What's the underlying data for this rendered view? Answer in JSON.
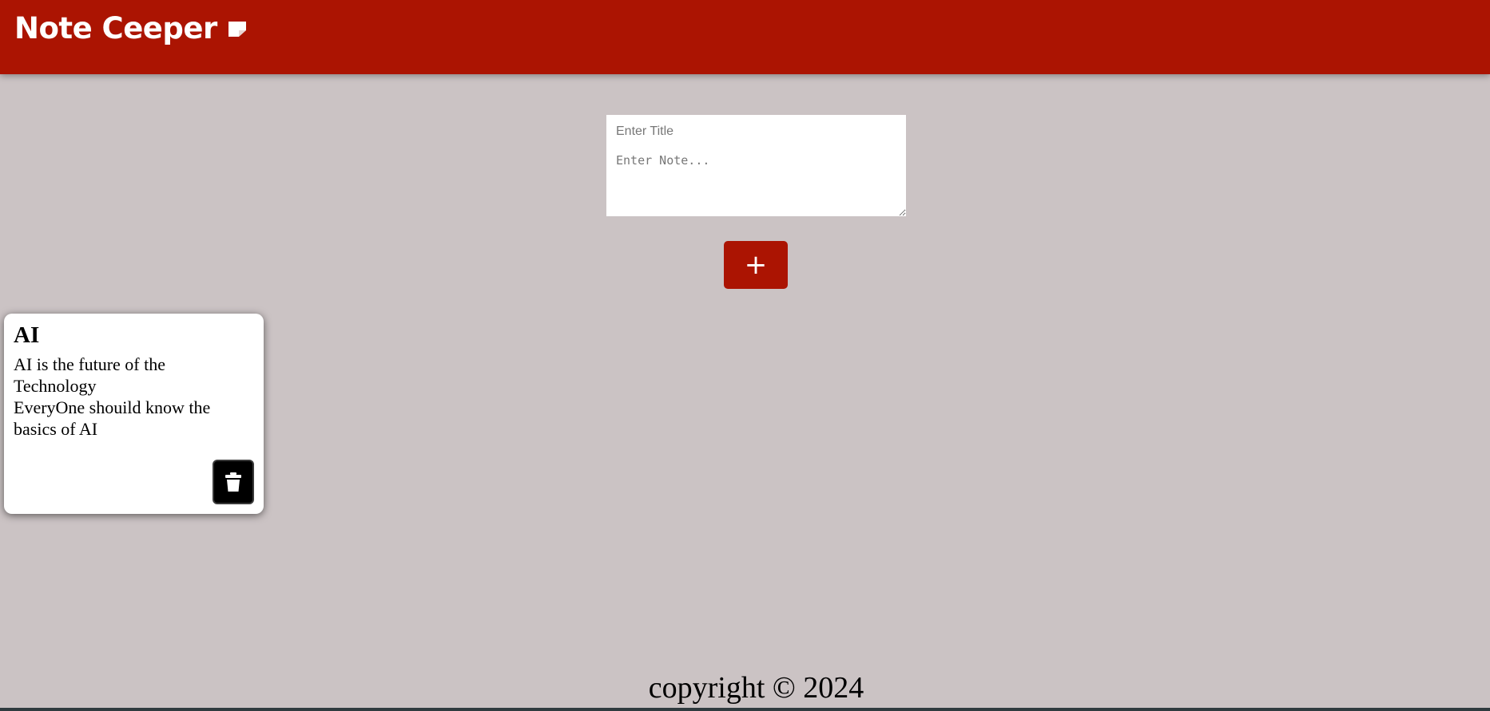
{
  "header": {
    "title": "Note Ceeper",
    "icon": "sticky-note-icon",
    "background_color": "#ab1402"
  },
  "form": {
    "title_placeholder": "Enter Title",
    "note_placeholder": "Enter Note...",
    "add_button_label": "+",
    "add_button_color": "#ab1402"
  },
  "notes": [
    {
      "title": "AI",
      "content": "AI is the future of the Technology\nEveryOne shouild know the basics of AI",
      "delete_icon": "trash-icon"
    }
  ],
  "footer": {
    "text": "copyright © 2024"
  },
  "page": {
    "background_color": "#cbc3c4"
  }
}
